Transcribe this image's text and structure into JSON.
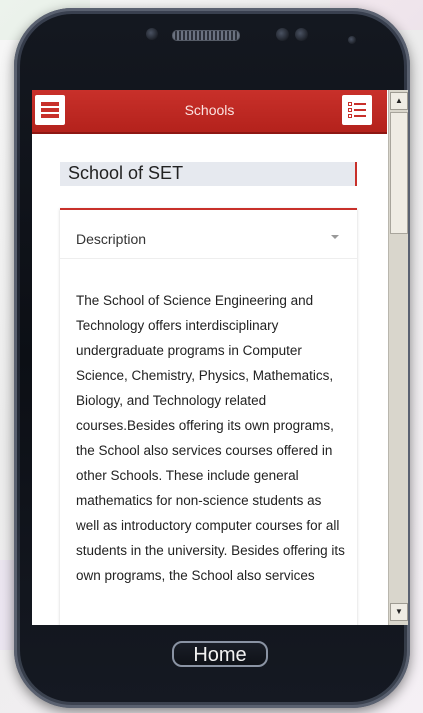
{
  "appbar": {
    "title": "Schools",
    "menu_icon": "menu-icon",
    "list_icon": "list-icon",
    "accent_color": "#c8302a"
  },
  "content": {
    "school_name": "School of SET",
    "section_label": "Description",
    "description": "The School of Science Engineering and Technology offers interdisciplinary undergraduate programs in Computer Science, Chemistry, Physics, Mathematics, Biology, and Technology related courses.Besides offering its own programs, the School also services courses offered in other Schools. These include general mathematics for non-science students as well as introductory computer courses for all students in the university. Besides offering its own programs, the School also services"
  },
  "device": {
    "home_label": "Home"
  }
}
